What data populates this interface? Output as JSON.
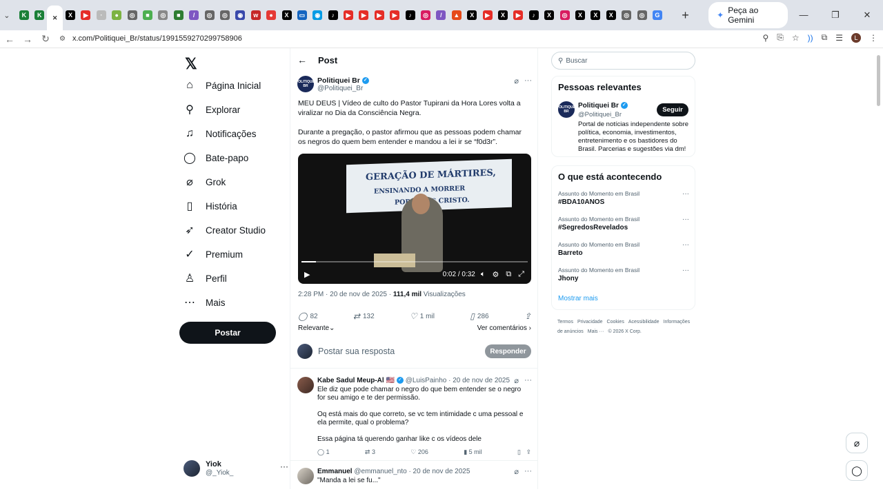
{
  "browser": {
    "tabs": [
      {
        "icon": "K",
        "color": "#1a7f37"
      },
      {
        "icon": "K",
        "color": "#1a7f37"
      },
      {
        "icon": "✕",
        "color": "#ffffff",
        "active": true
      },
      {
        "icon": "X",
        "color": "#000000"
      },
      {
        "icon": "▶",
        "color": "#e52d27"
      },
      {
        "icon": "·",
        "color": "#bbbbbb"
      },
      {
        "icon": "●",
        "color": "#7cb342"
      },
      {
        "icon": "◎",
        "color": "#666666"
      },
      {
        "icon": "■",
        "color": "#4caf50"
      },
      {
        "icon": "◎",
        "color": "#888888"
      },
      {
        "icon": "■",
        "color": "#2e7d32"
      },
      {
        "icon": "/",
        "color": "#7e57c2"
      },
      {
        "icon": "◎",
        "color": "#666666"
      },
      {
        "icon": "◎",
        "color": "#666666"
      },
      {
        "icon": "◉",
        "color": "#3949ab"
      },
      {
        "icon": "w",
        "color": "#c62828"
      },
      {
        "icon": "●",
        "color": "#e53935"
      },
      {
        "icon": "X",
        "color": "#000000"
      },
      {
        "icon": "▭",
        "color": "#1565c0"
      },
      {
        "icon": "◉",
        "color": "#039be5"
      },
      {
        "icon": "♪",
        "color": "#000000"
      },
      {
        "icon": "▶",
        "color": "#e52d27"
      },
      {
        "icon": "▶",
        "color": "#e52d27"
      },
      {
        "icon": "▶",
        "color": "#e52d27"
      },
      {
        "icon": "▶",
        "color": "#e52d27"
      },
      {
        "icon": "♪",
        "color": "#000000"
      },
      {
        "icon": "◎",
        "color": "#d81b60"
      },
      {
        "icon": "/",
        "color": "#7e57c2"
      },
      {
        "icon": "▲",
        "color": "#e64a19"
      },
      {
        "icon": "X",
        "color": "#000000"
      },
      {
        "icon": "▶",
        "color": "#e52d27"
      },
      {
        "icon": "X",
        "color": "#000000"
      },
      {
        "icon": "▶",
        "color": "#e52d27"
      },
      {
        "icon": "♪",
        "color": "#000000"
      },
      {
        "icon": "X",
        "color": "#000000"
      },
      {
        "icon": "◎",
        "color": "#d81b60"
      },
      {
        "icon": "X",
        "color": "#000000"
      },
      {
        "icon": "X",
        "color": "#000000"
      },
      {
        "icon": "X",
        "color": "#000000"
      },
      {
        "icon": "◎",
        "color": "#666666"
      },
      {
        "icon": "◎",
        "color": "#666666"
      },
      {
        "icon": "G",
        "color": "#4285f4"
      }
    ],
    "gemini_label": "Peça ao Gemini",
    "url": "x.com/Politiquei_Br/status/1991559270299758906",
    "profile_initial": "L"
  },
  "nav": {
    "items": [
      {
        "label": "Página Inicial",
        "icon": "⌂"
      },
      {
        "label": "Explorar",
        "icon": "⚲"
      },
      {
        "label": "Notificações",
        "icon": "♫"
      },
      {
        "label": "Bate-papo",
        "icon": "◯"
      },
      {
        "label": "Grok",
        "icon": "⌀"
      },
      {
        "label": "História",
        "icon": "▯"
      },
      {
        "label": "Creator Studio",
        "icon": "➶"
      },
      {
        "label": "Premium",
        "icon": "✓"
      },
      {
        "label": "Perfil",
        "icon": "♙"
      },
      {
        "label": "Mais",
        "icon": "⋯"
      }
    ],
    "post_label": "Postar",
    "user": {
      "name": "Yiok",
      "handle": "@_Yiok_"
    }
  },
  "post": {
    "header": "Post",
    "author": {
      "name": "Politiquei Br",
      "handle": "@Politiquei_Br",
      "avatar_text": "POLITIQUEI BR"
    },
    "text1": "MEU DEUS | Vídeo de culto do Pastor Tupirani da Hora Lores volta a viralizar no Dia da Consciência Negra.",
    "text2": "Durante a pregação, o pastor afirmou que as pessoas podem chamar os negros do quem bem entender e mandou a lei ir se “f0d3r”.",
    "video": {
      "banner1": "GERAÇÃO DE MÁRTIRES,",
      "banner2": "ENSINANDO A MORRER",
      "banner3": "POR JESUS CRISTO.",
      "time": "0:02 / 0:32",
      "progress": 0.0625
    },
    "meta_time": "2:28 PM · 20 de nov de 2025 · ",
    "meta_views": "111,4 mil",
    "meta_views_label": " Visualizações",
    "replies": "82",
    "reposts": "132",
    "likes": "1 mil",
    "bookmarks": "286",
    "sort": "Relevante",
    "see_comments": "Ver comentários",
    "reply_placeholder": "Postar sua resposta",
    "reply_button": "Responder"
  },
  "replies": [
    {
      "name": "Kabe Sadul Meup-Al 🇺🇸",
      "meta": "@LuisPainho · 20 de nov de 2025",
      "p1": "Ele diz que pode chamar o negro do que bem entender se o negro for seu amigo e te der permissão.",
      "p2": "Oq está mais do que correto, se vc tem intimidade c uma pessoal e ela permite, qual o problema?",
      "p3": "Essa página tá querendo ganhar like c os vídeos dele",
      "replies": "1",
      "reposts": "3",
      "likes": "206",
      "views": "5 mil"
    },
    {
      "name": "Emmanuel",
      "meta": "@emmanuel_nto · 20 de nov de 2025",
      "p1": "\"Manda a lei se fu...\""
    }
  ],
  "right": {
    "search_placeholder": "Buscar",
    "relevant_title": "Pessoas relevantes",
    "rel_name": "Politiquei Br",
    "rel_handle": "@Politiquei_Br",
    "follow": "Seguir",
    "rel_bio": "Portal de notícias independente sobre política, economia, investimentos, entretenimento e os bastidores do Brasil. Parcerias e sugestões via dm!",
    "trends_title": "O que está acontecendo",
    "trends": [
      {
        "cat": "Assunto do Momento em Brasil",
        "name": "#BDA10ANOS"
      },
      {
        "cat": "Assunto do Momento em Brasil",
        "name": "#SegredosRevelados"
      },
      {
        "cat": "Assunto do Momento em Brasil",
        "name": "Barreto"
      },
      {
        "cat": "Assunto do Momento em Brasil",
        "name": "Jhony"
      }
    ],
    "show_more": "Mostrar mais",
    "footer": [
      "Termos",
      "Privacidade",
      "Cookies",
      "Acessibilidade",
      "Informações de anúncios",
      "Mais ···",
      "© 2026 X Corp."
    ]
  }
}
